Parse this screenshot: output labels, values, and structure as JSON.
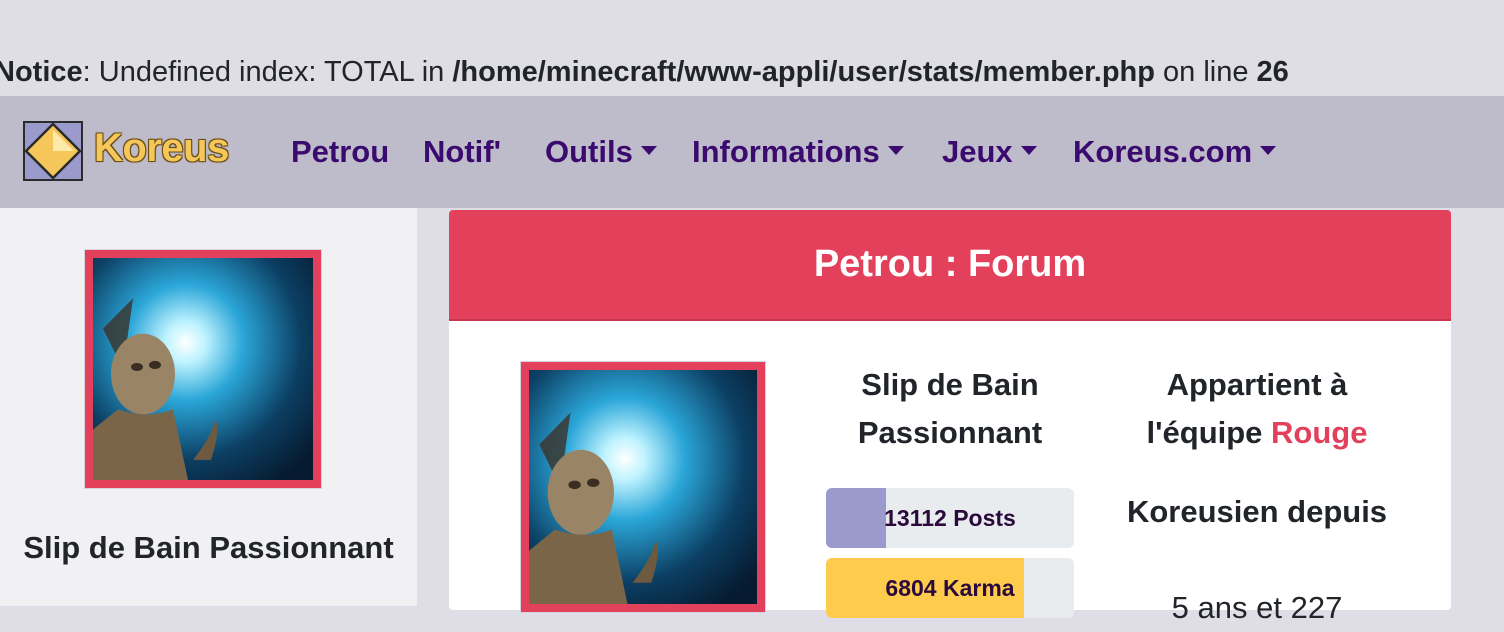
{
  "notice": {
    "label": "Notice",
    "message": ": Undefined index: TOTAL in ",
    "path": "/home/minecraft/www-appli/user/stats/member.php",
    "on_line": " on line ",
    "line": "26"
  },
  "navbar": {
    "brand": "Koreus",
    "items": [
      {
        "label": "Petrou",
        "dropdown": false
      },
      {
        "label": "Notif'",
        "dropdown": false
      },
      {
        "label": "Outils",
        "dropdown": true
      },
      {
        "label": "Informations",
        "dropdown": true
      },
      {
        "label": "Jeux",
        "dropdown": true
      },
      {
        "label": "Koreus.com",
        "dropdown": true
      }
    ]
  },
  "sidebar": {
    "title": "Slip de Bain Passionnant"
  },
  "card": {
    "title": "Petrou : Forum",
    "rank": "Slip de Bain Passionnant",
    "team_prefix": "Appartient à l'équipe ",
    "team_name": "Rouge",
    "stats": [
      {
        "label": "13112 Posts",
        "fill_percent": 24,
        "color": "#9a9acc"
      },
      {
        "label": "6804 Karma",
        "fill_percent": 80,
        "color": "#fecb4d"
      }
    ],
    "member_since_label": "Koreusien depuis",
    "member_duration": "5 ans et 227"
  },
  "colors": {
    "accent": "#e2405b",
    "nav_text": "#3b0a6e",
    "navbar_bg": "#bebbca",
    "page_bg": "#dfdde6"
  }
}
